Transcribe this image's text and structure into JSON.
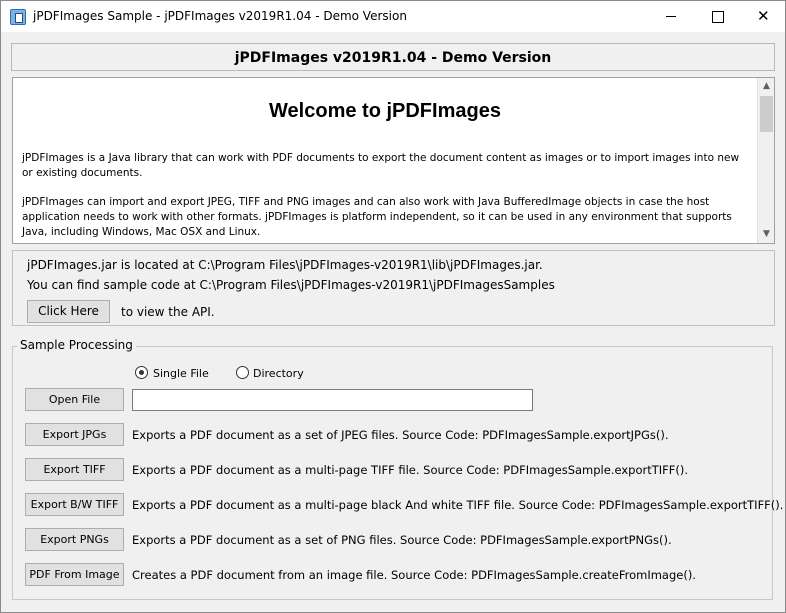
{
  "window": {
    "title": "jPDFImages Sample - jPDFImages v2019R1.04 - Demo Version",
    "close_glyph": "✕"
  },
  "banner": {
    "title": "jPDFImages v2019R1.04 - Demo Version"
  },
  "welcome": {
    "heading": "Welcome to jPDFImages",
    "paragraph1": "jPDFImages is a Java library that can work with PDF documents to export the document content as images or to import images into new or existing documents.",
    "paragraph2": "jPDFImages can import and export JPEG, TIFF and PNG images and can also work with Java BufferedImage objects in case the host application needs to work with other formats. jPDFImages is platform independent, so it can be used in any environment that supports Java, including Windows, Mac OSX and Linux."
  },
  "scrollbar": {
    "up_glyph": "▲",
    "down_glyph": "▼"
  },
  "info": {
    "jar_location": "jPDFImages.jar is located at C:\\Program Files\\jPDFImages-v2019R1\\lib\\jPDFImages.jar.",
    "sample_location": "You can find sample code at C:\\Program Files\\jPDFImages-v2019R1\\jPDFImagesSamples",
    "click_here_label": "Click Here",
    "view_api_text": "to view the API."
  },
  "sample_processing": {
    "title": "Sample Processing",
    "radio_single_label": "Single File",
    "radio_directory_label": "Directory",
    "selected_mode": "Single File",
    "open_file_label": "Open File",
    "file_path_value": "",
    "actions": [
      {
        "label": "Export JPGs",
        "description": "Exports a PDF document as a set of JPEG files. Source Code: PDFImagesSample.exportJPGs()."
      },
      {
        "label": "Export TIFF",
        "description": "Exports a PDF document as a multi-page TIFF file.  Source Code: PDFImagesSample.exportTIFF()."
      },
      {
        "label": "Export B/W TIFF",
        "description": "Exports a PDF document as a multi-page black And white TIFF file.  Source Code: PDFImagesSample.exportTIFF()."
      },
      {
        "label": "Export PNGs",
        "description": "Exports a PDF document as a set of PNG files.  Source Code: PDFImagesSample.exportPNGs()."
      },
      {
        "label": "PDF From Image",
        "description": "Creates a PDF document from an image file.  Source Code: PDFImagesSample.createFromImage()."
      }
    ]
  }
}
